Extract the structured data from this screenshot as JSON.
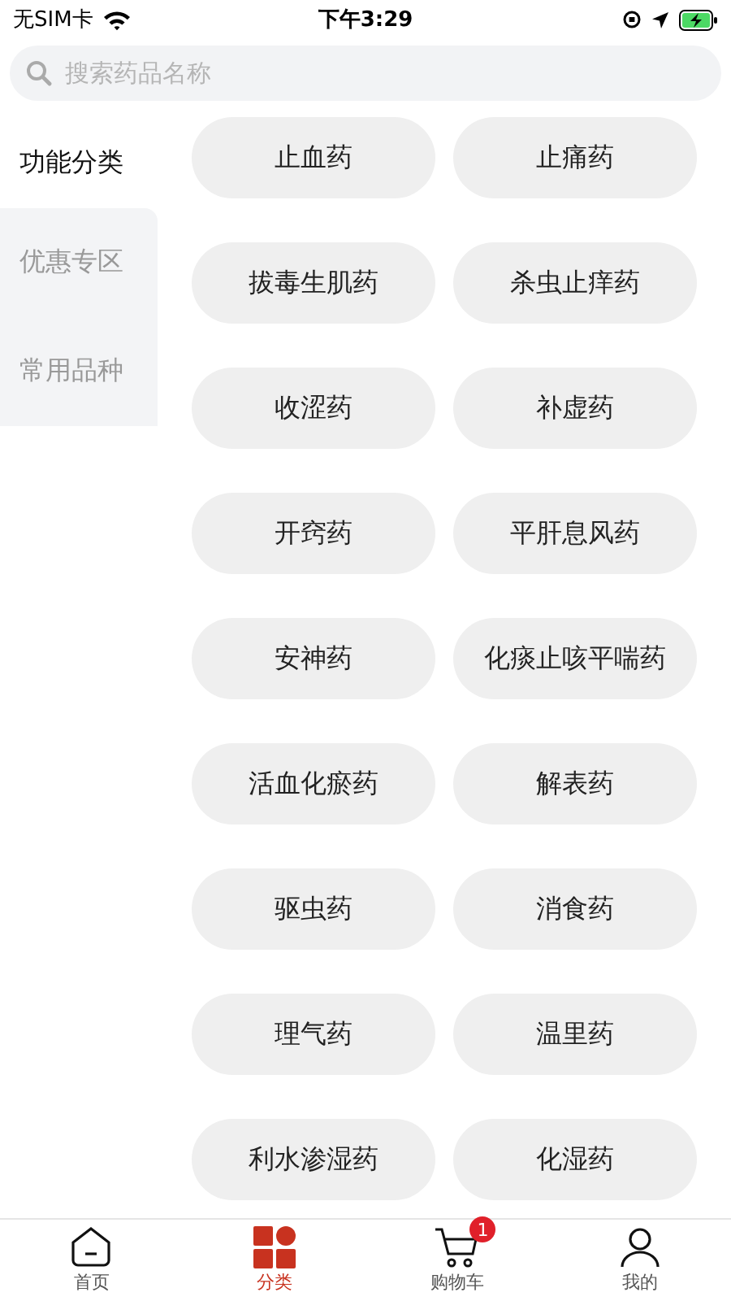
{
  "status_bar": {
    "carrier": "无SIM卡",
    "time": "下午3:29"
  },
  "search": {
    "placeholder": "搜索药品名称"
  },
  "sidebar": {
    "items": [
      {
        "label": "功能分类",
        "selected": true
      },
      {
        "label": "优惠专区",
        "selected": false
      },
      {
        "label": "常用品种",
        "selected": false
      }
    ]
  },
  "categories": [
    "止血药",
    "止痛药",
    "拔毒生肌药",
    "杀虫止痒药",
    "收涩药",
    "补虚药",
    "开窍药",
    "平肝息风药",
    "安神药",
    "化痰止咳平喘药",
    "活血化瘀药",
    "解表药",
    "驱虫药",
    "消食药",
    "理气药",
    "温里药",
    "利水渗湿药",
    "化湿药"
  ],
  "tab_bar": [
    {
      "kind": "home",
      "label": "首页",
      "selected": false
    },
    {
      "kind": "category",
      "label": "分类",
      "selected": true
    },
    {
      "kind": "cart",
      "label": "购物车",
      "selected": false,
      "badge": "1"
    },
    {
      "kind": "profile",
      "label": "我的",
      "selected": false
    }
  ]
}
